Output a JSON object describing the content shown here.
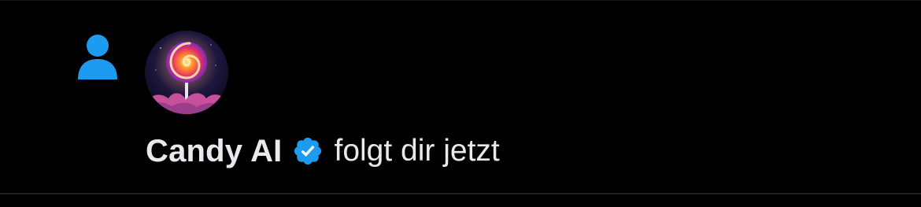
{
  "notification": {
    "type_icon": "person-follow-icon",
    "avatar_icon": "lollipop-avatar",
    "account_name": "Candy AI",
    "verified_icon": "verified-badge-icon",
    "action_text": "folgt dir jetzt",
    "colors": {
      "background": "#000000",
      "text": "#e7e9ea",
      "accent": "#1d9bf0",
      "divider": "#1c1e21"
    }
  }
}
